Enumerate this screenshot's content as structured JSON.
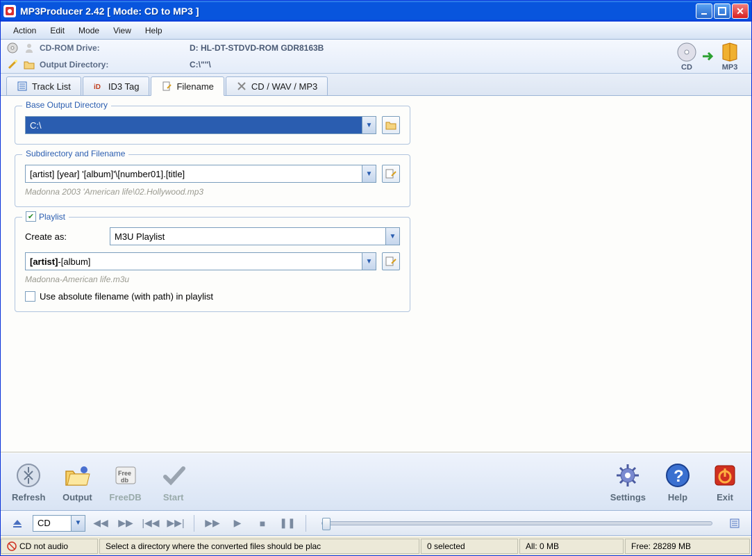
{
  "title": "MP3Producer 2.42 [ Mode: CD to MP3 ]",
  "menu": [
    "Action",
    "Edit",
    "Mode",
    "View",
    "Help"
  ],
  "info": {
    "drive_label": "CD-ROM Drive:",
    "drive_value": "D: HL-DT-STDVD-ROM GDR8163B",
    "output_label": "Output Directory:",
    "output_value": "C:\\\"\"\\"
  },
  "format_icons": {
    "cd": "CD",
    "mp3": "MP3"
  },
  "tabs": [
    {
      "label": "Track List"
    },
    {
      "label": "ID3 Tag"
    },
    {
      "label": "Filename"
    },
    {
      "label": "CD / WAV / MP3"
    }
  ],
  "panel": {
    "base_dir_legend": "Base Output Directory",
    "base_dir_value": "C:\\",
    "subdir_legend": "Subdirectory and Filename",
    "subdir_value": "[artist] [year] '[album]'\\[number01].[title]",
    "subdir_example": "Madonna 2003 'American life\\02.Hollywood.mp3",
    "playlist_legend": "Playlist",
    "playlist_checked": true,
    "create_as_label": "Create as:",
    "create_as_value": "M3U Playlist",
    "playlist_pattern": "[artist]-[album]",
    "playlist_pattern_bold": "[artist]",
    "playlist_pattern_rest": "-[album]",
    "playlist_example": "Madonna-American life.m3u",
    "absolute_label": "Use absolute filename (with path) in playlist",
    "absolute_checked": false
  },
  "toolbar": [
    {
      "name": "refresh",
      "label": "Refresh"
    },
    {
      "name": "output",
      "label": "Output"
    },
    {
      "name": "freedb",
      "label": "FreeDB"
    },
    {
      "name": "start",
      "label": "Start"
    }
  ],
  "toolbar_right": [
    {
      "name": "settings",
      "label": "Settings"
    },
    {
      "name": "help",
      "label": "Help"
    },
    {
      "name": "exit",
      "label": "Exit"
    }
  ],
  "player": {
    "source": "CD"
  },
  "status": {
    "cd": "CD not audio",
    "hint": "Select a directory where the converted files should be plac",
    "selected": "0 selected",
    "all": "All:  0 MB",
    "free": "Free:  28289 MB"
  }
}
